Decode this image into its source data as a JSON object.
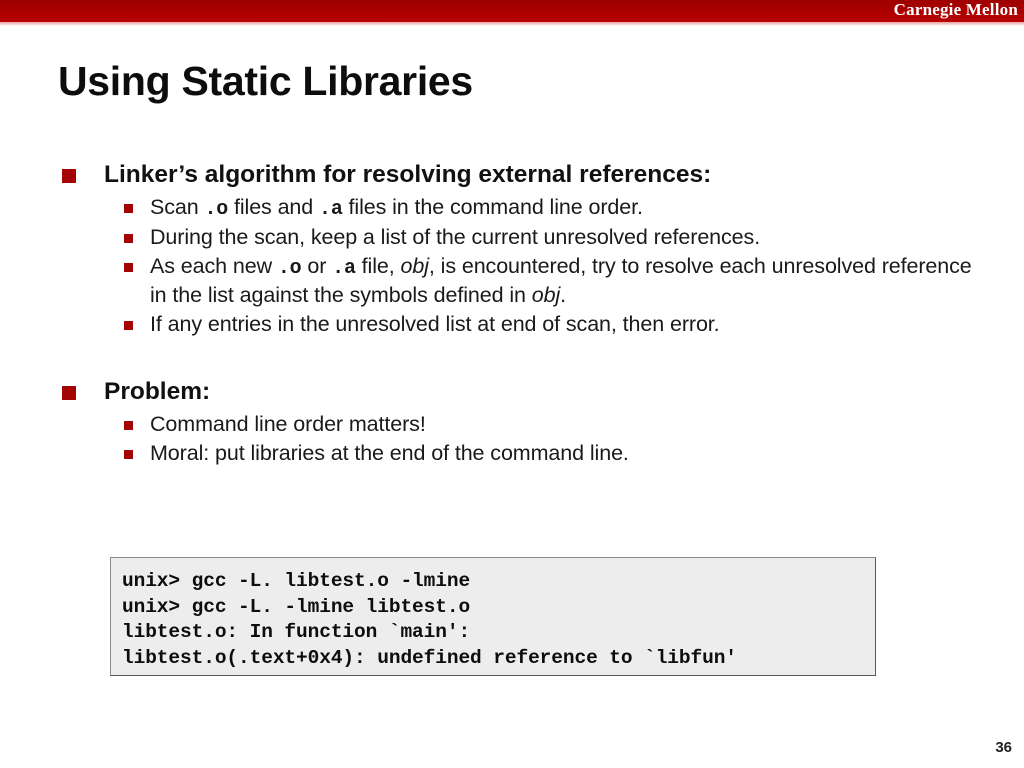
{
  "header": {
    "brand": "Carnegie Mellon",
    "band_color": "#a30000",
    "underline_color": "#e8a2a2"
  },
  "title": "Using Static Libraries",
  "theme": {
    "bullet_color": "#a30505",
    "text_color": "#111111",
    "code_bg": "#ededed",
    "code_border": "#8a8a8a"
  },
  "content": {
    "groups": [
      {
        "heading": "Linker’s algorithm for resolving external references:",
        "bullets": [
          {
            "parts": [
              {
                "text": "Scan ",
                "style": "plain"
              },
              {
                "text": ".o",
                "style": "mono"
              },
              {
                "text": " files and ",
                "style": "plain"
              },
              {
                "text": ".a",
                "style": "mono"
              },
              {
                "text": " files in the command line order.",
                "style": "plain"
              }
            ]
          },
          {
            "parts": [
              {
                "text": "During the scan, keep a list of the current unresolved references.",
                "style": "plain"
              }
            ]
          },
          {
            "parts": [
              {
                "text": "As each new ",
                "style": "plain"
              },
              {
                "text": ".o",
                "style": "mono"
              },
              {
                "text": " or ",
                "style": "plain"
              },
              {
                "text": ".a",
                "style": "mono"
              },
              {
                "text": " file, ",
                "style": "plain"
              },
              {
                "text": "obj",
                "style": "italic"
              },
              {
                "text": ", is encountered, try to resolve each unresolved reference in the list against the symbols defined in ",
                "style": "plain"
              },
              {
                "text": "obj",
                "style": "italic"
              },
              {
                "text": ".",
                "style": "plain"
              }
            ]
          },
          {
            "parts": [
              {
                "text": "If any entries in the unresolved list at end of scan, then error.",
                "style": "plain"
              }
            ]
          }
        ]
      },
      {
        "heading": "Problem:",
        "bullets": [
          {
            "parts": [
              {
                "text": "Command line order matters!",
                "style": "plain"
              }
            ]
          },
          {
            "parts": [
              {
                "text": "Moral: put libraries at the end of the command line.",
                "style": "plain"
              }
            ]
          }
        ]
      }
    ]
  },
  "code_block": {
    "lines": [
      "unix> gcc -L. libtest.o -lmine",
      "unix> gcc -L. -lmine libtest.o",
      "libtest.o: In function `main':",
      "libtest.o(.text+0x4): undefined reference to `libfun'"
    ]
  },
  "page_number": "36"
}
